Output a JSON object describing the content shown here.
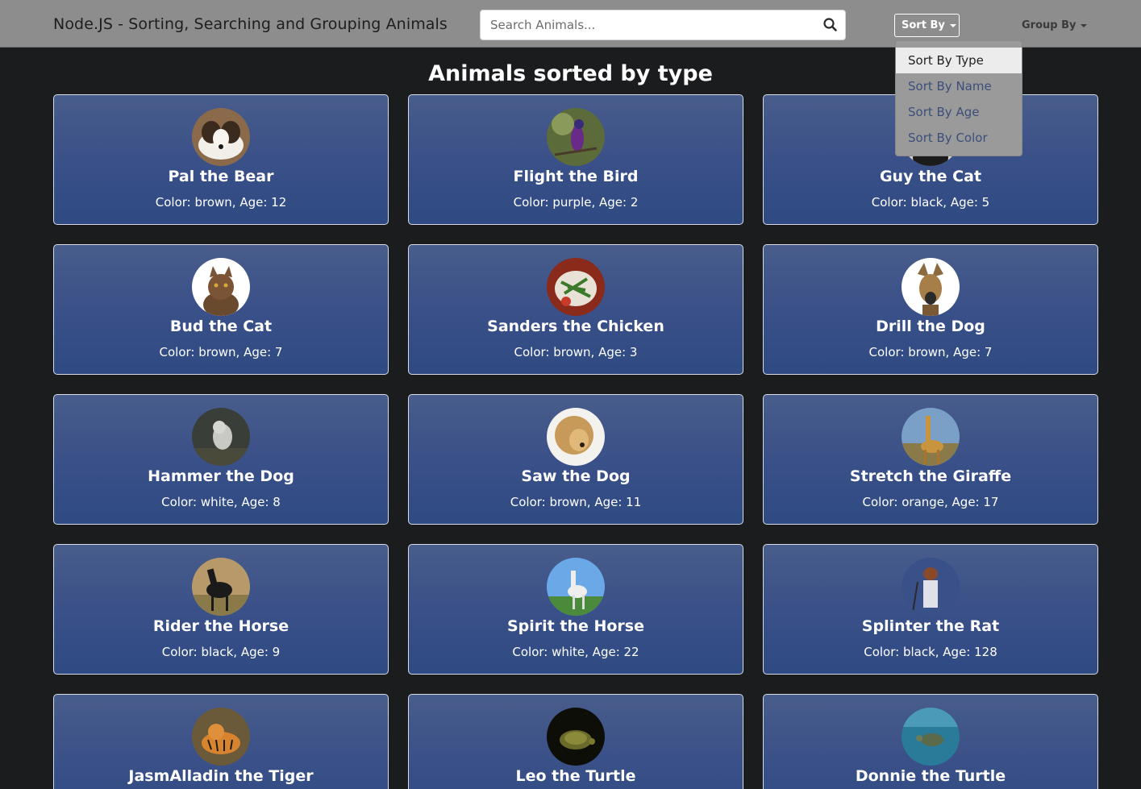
{
  "navbar": {
    "brand": "Node.JS - Sorting, Searching and Grouping Animals",
    "search_placeholder": "Search Animals...",
    "sort_label": "Sort By",
    "group_label": "Group By"
  },
  "sort_menu": {
    "items": [
      "Sort By Type",
      "Sort By Name",
      "Sort By Age",
      "Sort By Color"
    ],
    "active": "Sort By Type"
  },
  "page_title": "Animals sorted by type",
  "animals": [
    {
      "name": "Pal the Bear",
      "info": "Color: brown, Age: 12"
    },
    {
      "name": "Flight the Bird",
      "info": "Color: purple, Age: 2"
    },
    {
      "name": "Guy the Cat",
      "info": "Color: black, Age: 5"
    },
    {
      "name": "Bud the Cat",
      "info": "Color: brown, Age: 7"
    },
    {
      "name": "Sanders the Chicken",
      "info": "Color: brown, Age: 3"
    },
    {
      "name": "Drill the Dog",
      "info": "Color: brown, Age: 7"
    },
    {
      "name": "Hammer the Dog",
      "info": "Color: white, Age: 8"
    },
    {
      "name": "Saw the Dog",
      "info": "Color: brown, Age: 11"
    },
    {
      "name": "Stretch the Giraffe",
      "info": "Color: orange, Age: 17"
    },
    {
      "name": "Rider the Horse",
      "info": "Color: black, Age: 9"
    },
    {
      "name": "Spirit the Horse",
      "info": "Color: white, Age: 22"
    },
    {
      "name": "Splinter the Rat",
      "info": "Color: black, Age: 128"
    },
    {
      "name": "JasmAlladin the Tiger",
      "info": ""
    },
    {
      "name": "Leo the Turtle",
      "info": ""
    },
    {
      "name": "Donnie the Turtle",
      "info": ""
    }
  ],
  "colors": {
    "navbar_bg": "#8d8d8d",
    "page_bg": "#1b1c1e",
    "card_gradient_top": "#485d8b",
    "card_gradient_bottom": "#2f4a83",
    "dropdown_link": "#3b4f7a"
  },
  "icons": {
    "search": "search-icon",
    "sort_caret": "caret-down-icon",
    "group_caret": "caret-down-icon"
  }
}
